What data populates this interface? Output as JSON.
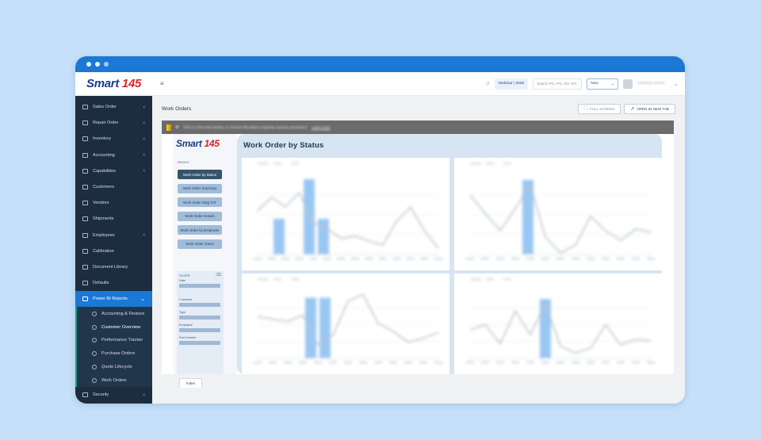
{
  "window": {
    "dots": 3
  },
  "logo": {
    "word": "Smart",
    "num": "145"
  },
  "sidebar": {
    "items": [
      {
        "label": "Sales Order",
        "chev": "‹"
      },
      {
        "label": "Repair Order",
        "chev": "‹"
      },
      {
        "label": "Inventory",
        "chev": "‹"
      },
      {
        "label": "Accounting",
        "chev": "‹"
      },
      {
        "label": "Capabilities",
        "chev": "‹"
      },
      {
        "label": "Customers",
        "chev": ""
      },
      {
        "label": "Vendors",
        "chev": ""
      },
      {
        "label": "Shipments",
        "chev": ""
      },
      {
        "label": "Employees",
        "chev": "‹"
      },
      {
        "label": "Calibration",
        "chev": ""
      },
      {
        "label": "Document Library",
        "chev": ""
      },
      {
        "label": "Defaults",
        "chev": ""
      },
      {
        "label": "Power BI Reports",
        "chev": "⌄"
      }
    ],
    "subitems": [
      {
        "label": "Accounting & Finance"
      },
      {
        "label": "Customer Overview"
      },
      {
        "label": "Performance Tracker"
      },
      {
        "label": "Purchase Orders"
      },
      {
        "label": "Quote Lifecycle"
      },
      {
        "label": "Work Orders"
      }
    ],
    "footer_item": {
      "label": "Security",
      "chev": "‹"
    }
  },
  "topbar": {
    "menu_icon": "≡",
    "bell_icon": "♫",
    "webinar_label": "Webinar | 2026",
    "search_placeholder": "Search PO, PO, SO, RO",
    "new_label": "New",
    "new_caret": "⌄",
    "user_name": "Client111 Simon",
    "user_caret": "⌄"
  },
  "page": {
    "title": "Work Orders",
    "fullscreen_label": "FULL SCREEN",
    "newtab_label": "OPEN IN NEW TAB"
  },
  "banner": {
    "text": "This is a free trial version, to remove this label a capacity must be purchased.",
    "link": "Learn more"
  },
  "report": {
    "logo_word": "Smart",
    "logo_num": "145",
    "title": "Work Order by Status",
    "pages_label": "PAGES",
    "pages": [
      {
        "label": "Work Order by Status",
        "active": true
      },
      {
        "label": "Work Order Summary",
        "active": false
      },
      {
        "label": "Work Order Stag TAT",
        "active": false
      },
      {
        "label": "Work Order Details",
        "active": false
      },
      {
        "label": "Work Order by Employee",
        "active": false
      },
      {
        "label": "Work Order Gates",
        "active": false
      }
    ],
    "filter": {
      "title": "FILTER",
      "labels": [
        "Date",
        "Customer",
        "Type",
        "Employee",
        "Part Number"
      ]
    }
  },
  "tabs": [
    {
      "label": "Index"
    }
  ],
  "colors": {
    "titlebar": "#1b78d4",
    "sidebar_bg": "#1c2d3f",
    "active_nav": "#1b78d4",
    "report_panel": "#d7e4f2",
    "bar": "#8fc1f2",
    "line": "#b8bcc2"
  },
  "chart_data": [
    {
      "type": "bar",
      "bars": [
        0.45,
        0.95,
        0.45
      ],
      "line": [
        0.55,
        0.72,
        0.6,
        0.78,
        0.4,
        0.33,
        0.2,
        0.23,
        0.17,
        0.12,
        0.42,
        0.6,
        0.3,
        0.08
      ]
    },
    {
      "type": "bar",
      "bars": [
        0.94
      ],
      "line": [
        0.75,
        0.52,
        0.3,
        0.58,
        0.88,
        0.22,
        0.02,
        0.12,
        0.48,
        0.3,
        0.18,
        0.32,
        0.28
      ]
    },
    {
      "type": "bar",
      "bars": [
        0.9,
        0.9
      ],
      "line": [
        0.62,
        0.58,
        0.55,
        0.64,
        0.2,
        0.34,
        0.85,
        0.95,
        0.52,
        0.4,
        0.24,
        0.3,
        0.38
      ]
    },
    {
      "type": "bar",
      "bars": [
        0.88
      ],
      "line": [
        0.42,
        0.5,
        0.22,
        0.7,
        0.35,
        0.82,
        0.18,
        0.08,
        0.15,
        0.5,
        0.2,
        0.28,
        0.26
      ]
    }
  ]
}
